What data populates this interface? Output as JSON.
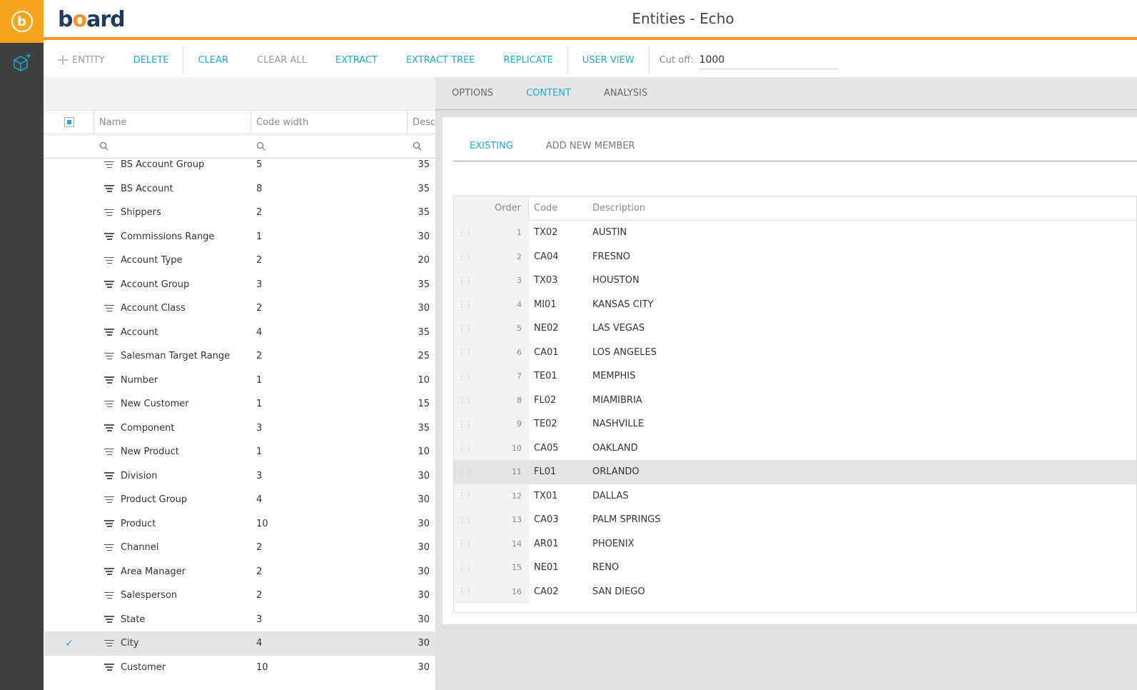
{
  "app": {
    "logo_letter": "b",
    "brand_first": "b",
    "brand_o": "o",
    "brand_rest": "ard",
    "title": "Entities - Echo"
  },
  "toolbar": {
    "entity": "ENTITY",
    "delete": "DELETE",
    "clear": "CLEAR",
    "clear_all": "CLEAR ALL",
    "extract": "EXTRACT",
    "extract_tree": "EXTRACT TREE",
    "replicate": "REPLICATE",
    "user_view": "USER VIEW",
    "cutoff_label": "Cut off:",
    "cutoff_value": "1000"
  },
  "entity_grid": {
    "columns": {
      "name": "Name",
      "code_width": "Code width",
      "desc": "Desc"
    },
    "rows": [
      {
        "name": "BS Account Group",
        "code_width": "5",
        "desc": "35",
        "selected": false
      },
      {
        "name": "BS Account",
        "code_width": "8",
        "desc": "35",
        "selected": false
      },
      {
        "name": "Shippers",
        "code_width": "2",
        "desc": "35",
        "selected": false
      },
      {
        "name": "Commissions Range",
        "code_width": "1",
        "desc": "30",
        "selected": false
      },
      {
        "name": "Account Type",
        "code_width": "2",
        "desc": "20",
        "selected": false
      },
      {
        "name": "Account Group",
        "code_width": "3",
        "desc": "35",
        "selected": false
      },
      {
        "name": "Account Class",
        "code_width": "2",
        "desc": "30",
        "selected": false
      },
      {
        "name": "Account",
        "code_width": "4",
        "desc": "35",
        "selected": false
      },
      {
        "name": "Salesman Target Range",
        "code_width": "2",
        "desc": "25",
        "selected": false
      },
      {
        "name": "Number",
        "code_width": "1",
        "desc": "10",
        "selected": false
      },
      {
        "name": "New Customer",
        "code_width": "1",
        "desc": "15",
        "selected": false
      },
      {
        "name": "Component",
        "code_width": "3",
        "desc": "35",
        "selected": false
      },
      {
        "name": "New Product",
        "code_width": "1",
        "desc": "10",
        "selected": false
      },
      {
        "name": "Division",
        "code_width": "3",
        "desc": "30",
        "selected": false
      },
      {
        "name": "Product Group",
        "code_width": "4",
        "desc": "30",
        "selected": false
      },
      {
        "name": "Product",
        "code_width": "10",
        "desc": "30",
        "selected": false
      },
      {
        "name": "Channel",
        "code_width": "2",
        "desc": "30",
        "selected": false
      },
      {
        "name": "Area Manager",
        "code_width": "2",
        "desc": "30",
        "selected": false
      },
      {
        "name": "Salesperson",
        "code_width": "2",
        "desc": "30",
        "selected": false
      },
      {
        "name": "State",
        "code_width": "3",
        "desc": "30",
        "selected": false
      },
      {
        "name": "City",
        "code_width": "4",
        "desc": "30",
        "selected": true
      },
      {
        "name": "Customer",
        "code_width": "10",
        "desc": "30",
        "selected": false
      }
    ]
  },
  "panel_tabs": {
    "options": "OPTIONS",
    "content": "CONTENT",
    "analysis": "ANALYSIS"
  },
  "content_tabs": {
    "existing": "EXISTING",
    "add_new": "ADD NEW MEMBER"
  },
  "members": {
    "columns": {
      "order": "Order",
      "code": "Code",
      "description": "Description"
    },
    "rows": [
      {
        "order": "1",
        "code": "TX02",
        "description": "AUSTIN",
        "selected": false
      },
      {
        "order": "2",
        "code": "CA04",
        "description": "FRESNO",
        "selected": false
      },
      {
        "order": "3",
        "code": "TX03",
        "description": "HOUSTON",
        "selected": false
      },
      {
        "order": "4",
        "code": "MI01",
        "description": "KANSAS CITY",
        "selected": false
      },
      {
        "order": "5",
        "code": "NE02",
        "description": "LAS VEGAS",
        "selected": false
      },
      {
        "order": "6",
        "code": "CA01",
        "description": "LOS ANGELES",
        "selected": false
      },
      {
        "order": "7",
        "code": "TE01",
        "description": "MEMPHIS",
        "selected": false
      },
      {
        "order": "8",
        "code": "FL02",
        "description": "MIAMIBRIA",
        "selected": false
      },
      {
        "order": "9",
        "code": "TE02",
        "description": "NASHVILLE",
        "selected": false
      },
      {
        "order": "10",
        "code": "CA05",
        "description": "OAKLAND",
        "selected": false
      },
      {
        "order": "11",
        "code": "FL01",
        "description": "ORLANDO",
        "selected": true
      },
      {
        "order": "12",
        "code": "TX01",
        "description": "DALLAS",
        "selected": false
      },
      {
        "order": "13",
        "code": "CA03",
        "description": "PALM SPRINGS",
        "selected": false
      },
      {
        "order": "14",
        "code": "AR01",
        "description": "PHOENIX",
        "selected": false
      },
      {
        "order": "15",
        "code": "NE01",
        "description": "RENO",
        "selected": false
      },
      {
        "order": "16",
        "code": "CA02",
        "description": "SAN DIEGO",
        "selected": false
      }
    ]
  },
  "colors": {
    "accent": "#1eaad3",
    "brand_orange": "#f7931e",
    "rail": "#3f3f3f"
  },
  "icons": {
    "rail": "cube-add-icon",
    "row": "hierarchy-lines-icon",
    "filter": "search-icon",
    "drag": "drag-handle-icon"
  }
}
